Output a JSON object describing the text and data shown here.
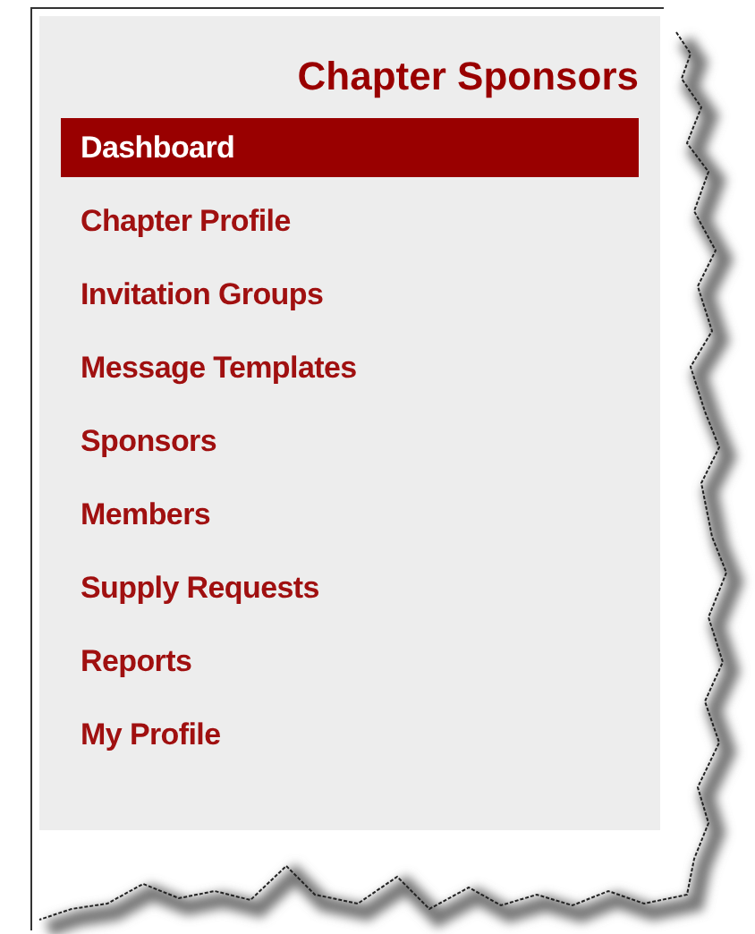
{
  "panel": {
    "title": "Chapter Sponsors",
    "items": [
      {
        "label": "Dashboard",
        "selected": true
      },
      {
        "label": "Chapter Profile",
        "selected": false
      },
      {
        "label": "Invitation Groups",
        "selected": false
      },
      {
        "label": "Message Templates",
        "selected": false
      },
      {
        "label": "Sponsors",
        "selected": false
      },
      {
        "label": "Members",
        "selected": false
      },
      {
        "label": "Supply Requests",
        "selected": false
      },
      {
        "label": "Reports",
        "selected": false
      },
      {
        "label": "My Profile",
        "selected": false
      }
    ]
  }
}
